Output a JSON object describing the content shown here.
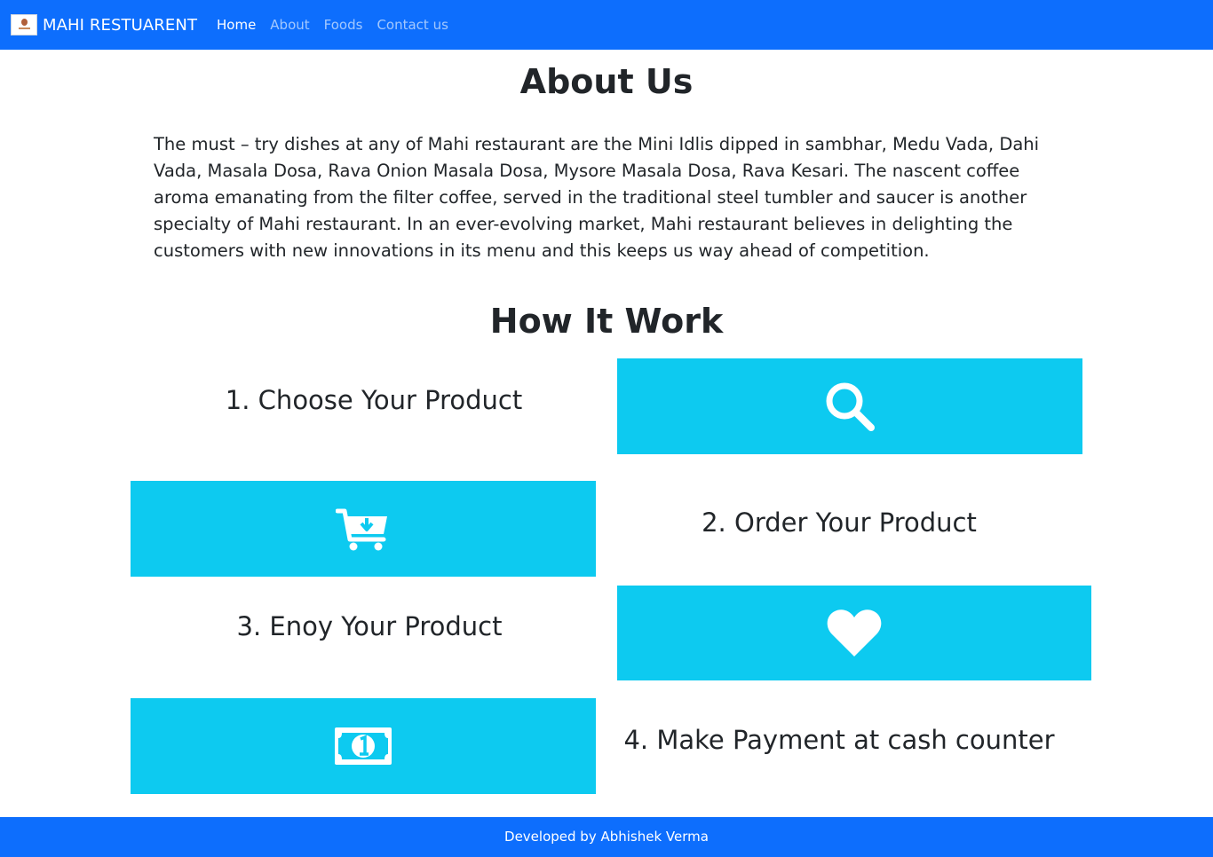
{
  "navbar": {
    "brand": "MAHI RESTUARENT",
    "logo_icon": "restaurant-logo-icon",
    "links": [
      {
        "label": "Home",
        "active": true
      },
      {
        "label": "About",
        "active": false
      },
      {
        "label": "Foods",
        "active": false
      },
      {
        "label": "Contact us",
        "active": false
      }
    ]
  },
  "about": {
    "title": "About Us",
    "text": "The must – try dishes at any of Mahi restaurant are the Mini Idlis dipped in sambhar, Medu Vada, Dahi Vada, Masala Dosa, Rava Onion Masala Dosa, Mysore Masala Dosa, Rava Kesari. The nascent coffee aroma emanating from the filter coffee, served in the traditional steel tumbler and saucer is another specialty of Mahi restaurant. In an ever-evolving market, Mahi restaurant believes in delighting the customers with new innovations in its menu and this keeps us way ahead of competition."
  },
  "how": {
    "title": "How It Work",
    "steps": [
      {
        "label": "1. Choose Your Product",
        "icon": "search-icon"
      },
      {
        "label": "2. Order Your Product",
        "icon": "cart-download-icon"
      },
      {
        "label": "3. Enoy Your Product",
        "icon": "heart-icon"
      },
      {
        "label": "4. Make Payment at cash counter",
        "icon": "money-bill-icon"
      }
    ]
  },
  "footer": {
    "text": "Developed by Abhishek Verma"
  },
  "colors": {
    "primary": "#0d6efd",
    "tile": "#0dcaf0",
    "text": "#212529"
  }
}
